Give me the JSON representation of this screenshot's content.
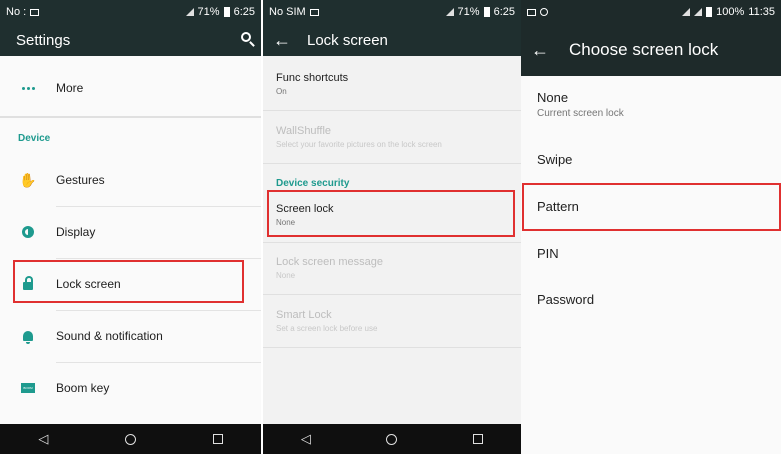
{
  "panel_settings": {
    "status": {
      "carrier": "No :",
      "battery": "71%",
      "time": "6:25"
    },
    "title": "Settings",
    "items_top": [
      {
        "label": "More",
        "icon": "more-dots-icon"
      }
    ],
    "section_device": "Device",
    "items": [
      {
        "label": "Gestures",
        "icon": "gesture-hand-icon"
      },
      {
        "label": "Display",
        "icon": "display-brightness-icon"
      },
      {
        "label": "Lock screen",
        "icon": "lock-icon",
        "highlighted": true
      },
      {
        "label": "Sound & notification",
        "icon": "bell-icon"
      },
      {
        "label": "Boom key",
        "icon": "boom-key-icon",
        "badge": "BOOM"
      }
    ]
  },
  "panel_lock": {
    "status": {
      "carrier": "No SIM",
      "battery": "71%",
      "time": "6:25"
    },
    "title": "Lock screen",
    "items": [
      {
        "title": "Func shortcuts",
        "sub": "On",
        "disabled": false
      },
      {
        "title": "WallShuffle",
        "sub": "Select your favorite pictures on the lock screen",
        "disabled": true
      }
    ],
    "section_security": "Device security",
    "security_items": [
      {
        "title": "Screen lock",
        "sub": "None",
        "disabled": false,
        "highlighted": true
      },
      {
        "title": "Lock screen message",
        "sub": "None",
        "disabled": true
      },
      {
        "title": "Smart Lock",
        "sub": "Set a screen lock before use",
        "disabled": true
      }
    ]
  },
  "panel_choose": {
    "status": {
      "battery": "100%",
      "time": "11:35"
    },
    "title": "Choose screen lock",
    "options": [
      {
        "title": "None",
        "sub": "Current screen lock"
      },
      {
        "title": "Swipe"
      },
      {
        "title": "Pattern",
        "highlighted": true
      },
      {
        "title": "PIN"
      },
      {
        "title": "Password"
      }
    ]
  },
  "colors": {
    "accent": "#1e9a8e",
    "highlight": "#e03030",
    "appbar": "#1f2f2f"
  }
}
